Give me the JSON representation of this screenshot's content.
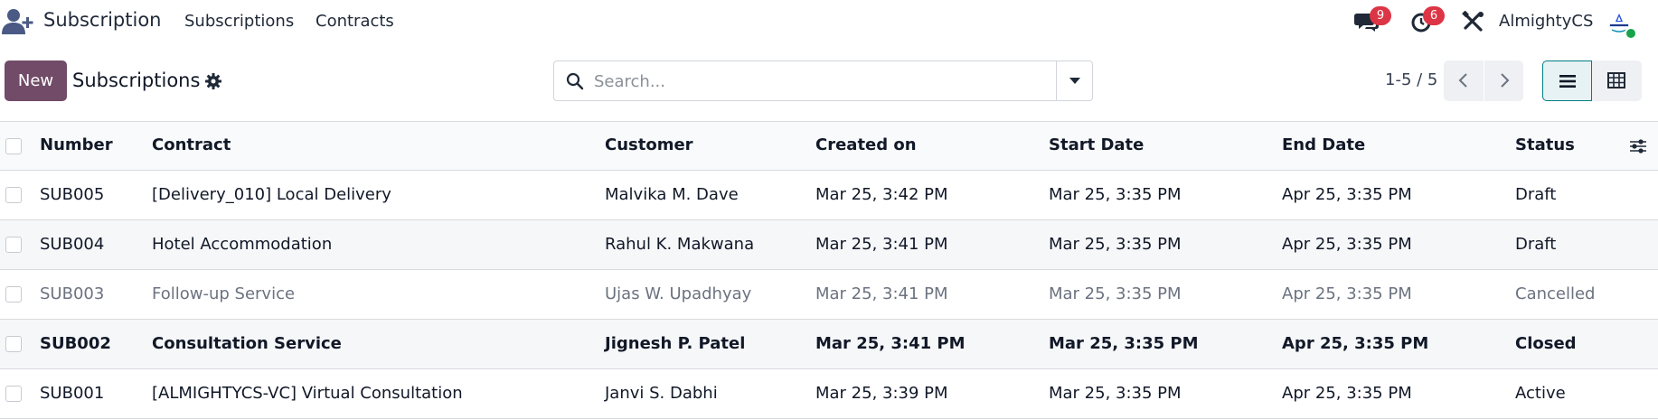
{
  "navbar": {
    "app_name": "Subscription",
    "menu": [
      "Subscriptions",
      "Contracts"
    ],
    "chat_count": "9",
    "activity_count": "6",
    "company": "AlmightyCS",
    "app_icon": "user-plus-icon",
    "icons": [
      "chat-icon",
      "clock-icon",
      "tools-icon"
    ],
    "badge_color": "#dc3545",
    "status_color": "#16a34a"
  },
  "control_panel": {
    "new_label": "New",
    "title": "Subscriptions",
    "search_placeholder": "Search...",
    "pager": "1-5 / 5",
    "brand_color": "#714b67",
    "active_view": "list",
    "views": [
      "list-view-icon",
      "pivot-view-icon"
    ]
  },
  "table": {
    "columns": [
      "Number",
      "Contract",
      "Customer",
      "Created on",
      "Start Date",
      "End Date",
      "Status"
    ],
    "rows": [
      {
        "number": "SUB005",
        "contract": "[Delivery_010] Local Delivery",
        "customer": "Malvika M. Dave",
        "created": "Mar 25, 3:42 PM",
        "start": "Mar 25, 3:35 PM",
        "end": "Apr 25, 3:35 PM",
        "status": "Draft"
      },
      {
        "number": "SUB004",
        "contract": "Hotel Accommodation",
        "customer": "Rahul K. Makwana",
        "created": "Mar 25, 3:41 PM",
        "start": "Mar 25, 3:35 PM",
        "end": "Apr 25, 3:35 PM",
        "status": "Draft"
      },
      {
        "number": "SUB003",
        "contract": "Follow-up Service",
        "customer": "Ujas W. Upadhyay",
        "created": "Mar 25, 3:41 PM",
        "start": "Mar 25, 3:35 PM",
        "end": "Apr 25, 3:35 PM",
        "status": "Cancelled"
      },
      {
        "number": "SUB002",
        "contract": "Consultation Service",
        "customer": "Jignesh P. Patel",
        "created": "Mar 25, 3:41 PM",
        "start": "Mar 25, 3:35 PM",
        "end": "Apr 25, 3:35 PM",
        "status": "Closed"
      },
      {
        "number": "SUB001",
        "contract": "[ALMIGHTYCS-VC] Virtual Consultation",
        "customer": "Janvi S. Dabhi",
        "created": "Mar 25, 3:39 PM",
        "start": "Mar 25, 3:35 PM",
        "end": "Apr 25, 3:35 PM",
        "status": "Active"
      }
    ]
  }
}
